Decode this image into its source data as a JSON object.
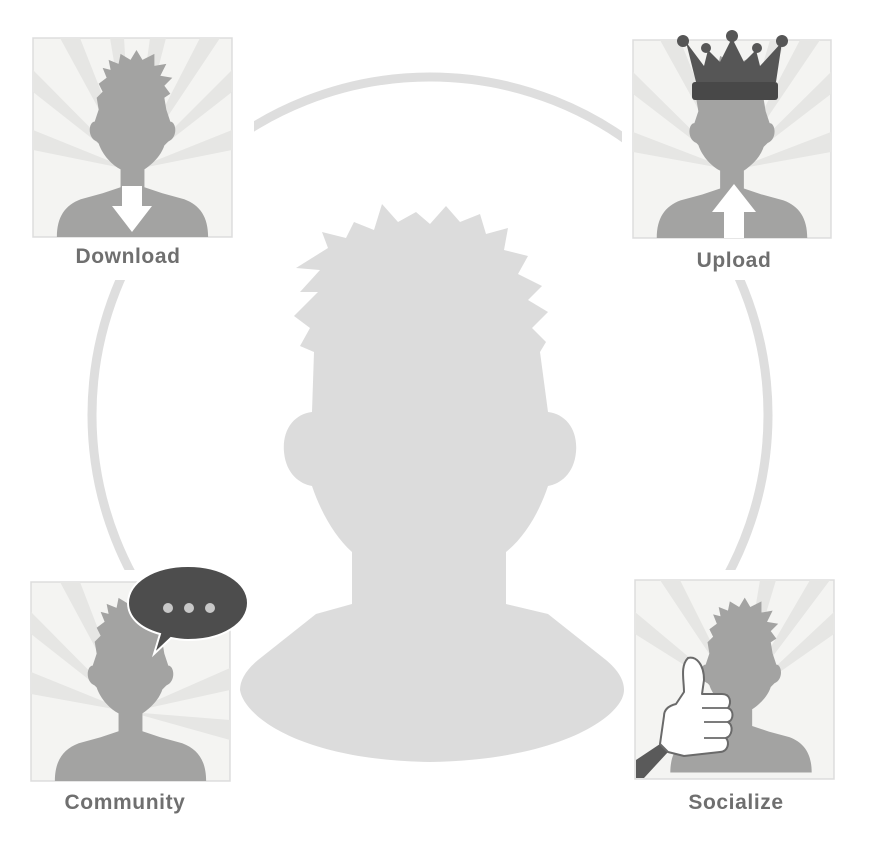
{
  "diagram": {
    "center": {
      "icon": "user-silhouette"
    },
    "nodes": [
      {
        "id": "download",
        "label": "Download",
        "icon": "arrow-down-icon"
      },
      {
        "id": "upload",
        "label": "Upload",
        "icon": "arrow-up-icon",
        "badge_icon": "crown-icon"
      },
      {
        "id": "community",
        "label": "Community",
        "icon": "speech-bubble-icon"
      },
      {
        "id": "socialize",
        "label": "Socialize",
        "icon": "thumbs-up-icon"
      }
    ]
  },
  "colors": {
    "ring": "#dedede",
    "center_silhouette": "#dcdcdc",
    "tile_silhouette": "#a3a3a2",
    "tile_background": "#f4f4f2",
    "tile_rays": "#e4e4e2",
    "label": "#6f6f6f",
    "bubble": "#4d4d4d",
    "crown": "#565656"
  }
}
